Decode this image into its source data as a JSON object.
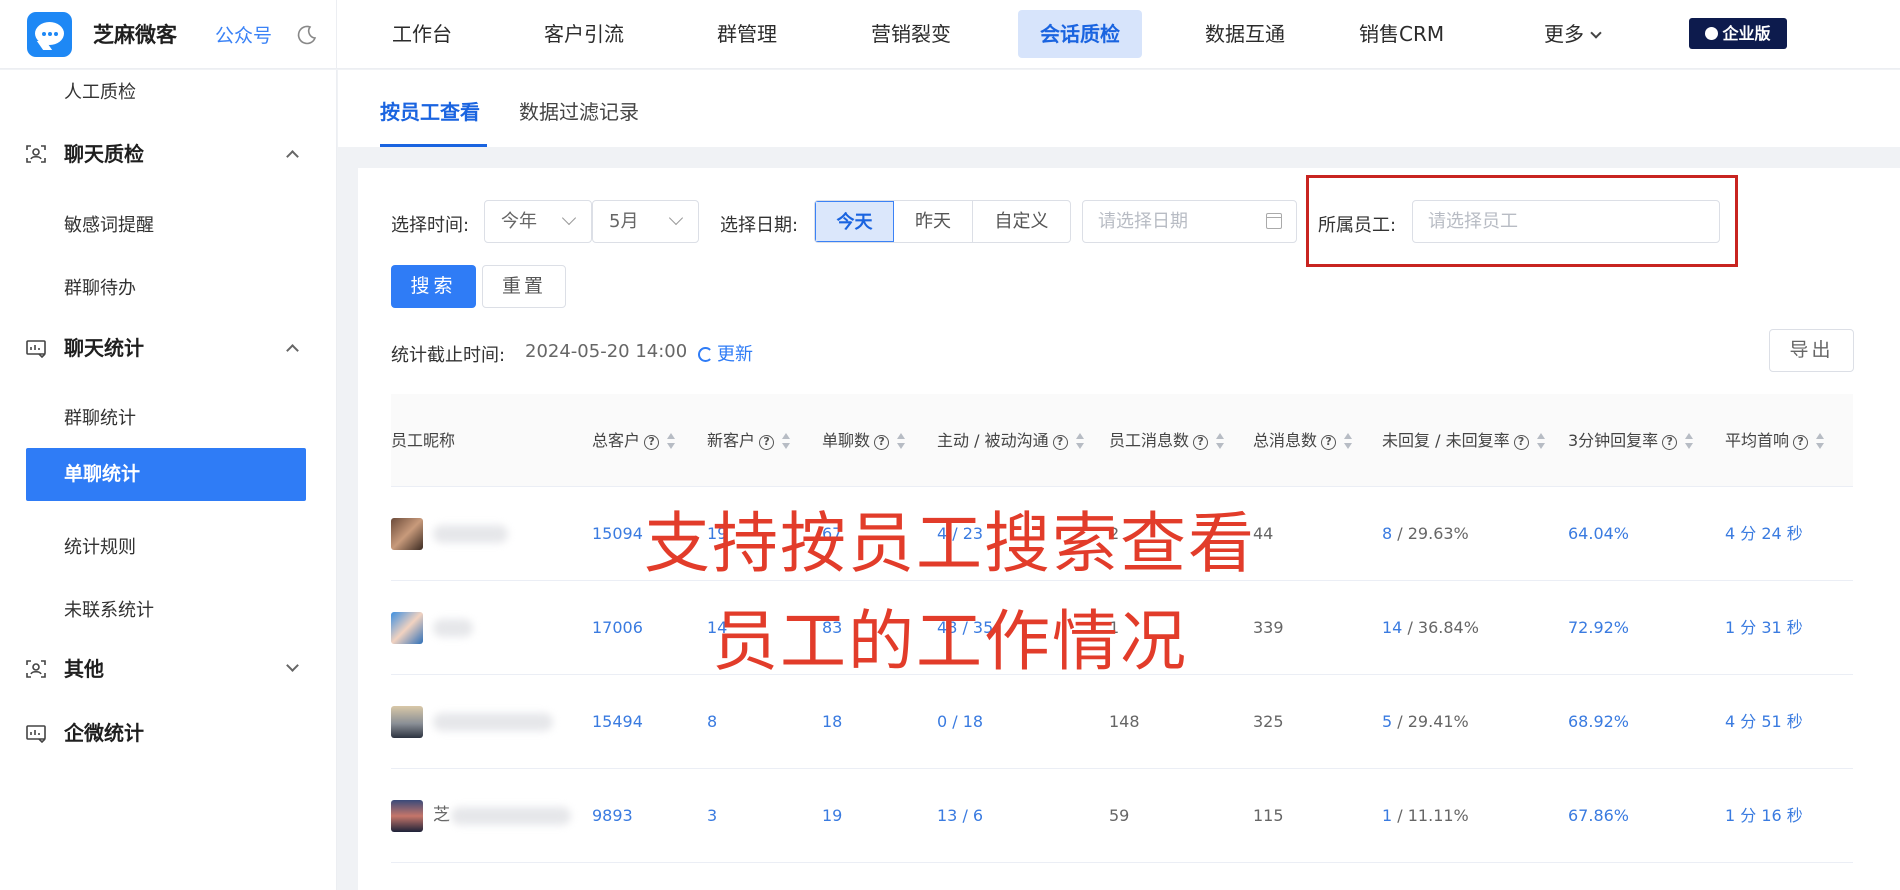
{
  "brand": {
    "name": "芝麻微客",
    "gzh_link": "公众号"
  },
  "nav": {
    "items": [
      "工作台",
      "客户引流",
      "群管理",
      "营销裂变",
      "会话质检",
      "数据互通",
      "销售CRM",
      "更多"
    ],
    "active": "会话质检",
    "enterprise_badge": "企业版"
  },
  "sidebar": {
    "partial_item": "人工质检",
    "groups": [
      {
        "label": "聊天质检",
        "icon": "user-scan-icon",
        "expanded": true,
        "items": [
          "敏感词提醒",
          "群聊待办"
        ]
      },
      {
        "label": "聊天统计",
        "icon": "stats-card-icon",
        "expanded": true,
        "items": [
          "群聊统计",
          "单聊统计",
          "统计规则",
          "未联系统计"
        ]
      },
      {
        "label": "其他",
        "icon": "user-scan-icon",
        "expanded": false,
        "items": []
      },
      {
        "label": "企微统计",
        "icon": "stats-card-icon",
        "expanded": false,
        "items": []
      }
    ],
    "active_item": "单聊统计"
  },
  "tabs": {
    "items": [
      "按员工查看",
      "数据过滤记录"
    ],
    "active": "按员工查看"
  },
  "filters": {
    "time_label": "选择时间:",
    "year_value": "今年",
    "month_value": "5月",
    "date_label": "选择日期:",
    "date_segments": [
      "今天",
      "昨天",
      "自定义"
    ],
    "date_segment_active": "今天",
    "date_placeholder": "请选择日期",
    "staff_label": "所属员工:",
    "staff_placeholder": "请选择员工"
  },
  "actions": {
    "search": "搜索",
    "reset": "重置",
    "export": "导出",
    "refresh": "更新"
  },
  "stats_meta": {
    "label": "统计截止时间:",
    "value": "2024-05-20 14:00"
  },
  "table": {
    "columns": [
      "员工昵称",
      "总客户",
      "新客户",
      "单聊数",
      "主动 / 被动沟通",
      "员工消息数",
      "总消息数",
      "未回复 / 未回复率",
      "3分钟回复率",
      "平均首响"
    ],
    "rows": [
      {
        "name_visible": "",
        "total": "15094",
        "new": "19",
        "chats": "67",
        "active_a": "4",
        "active_b": "23",
        "staff_msgs": "2",
        "total_msgs": "44",
        "unreplied": "8",
        "unreplied_rate": "29.63%",
        "rate3m": "64.04%",
        "first_resp": "4 分 24 秒"
      },
      {
        "name_visible": "",
        "total": "17006",
        "new": "14",
        "chats": "83",
        "active_a": "48",
        "active_b": "35",
        "staff_msgs": "1",
        "total_msgs": "339",
        "unreplied": "14",
        "unreplied_rate": "36.84%",
        "rate3m": "72.92%",
        "first_resp": "1 分 31 秒"
      },
      {
        "name_visible": "",
        "total": "15494",
        "new": "8",
        "chats": "18",
        "active_a": "0",
        "active_b": "18",
        "staff_msgs": "148",
        "total_msgs": "325",
        "unreplied": "5",
        "unreplied_rate": "29.41%",
        "rate3m": "68.92%",
        "first_resp": "4 分 51 秒"
      },
      {
        "name_visible": "芝",
        "total": "9893",
        "new": "3",
        "chats": "19",
        "active_a": "13",
        "active_b": "6",
        "staff_msgs": "59",
        "total_msgs": "115",
        "unreplied": "1",
        "unreplied_rate": "11.11%",
        "rate3m": "67.86%",
        "first_resp": "1 分 16 秒"
      }
    ]
  },
  "overlay": {
    "line1": "支持按员工搜索查看",
    "line2": "员工的工作情况",
    "color": "#e23c2a"
  },
  "colors": {
    "primary": "#2f7cf6",
    "link": "#3a7be0",
    "highlight_frame": "#c82420",
    "badge": "#0d1b4d"
  }
}
